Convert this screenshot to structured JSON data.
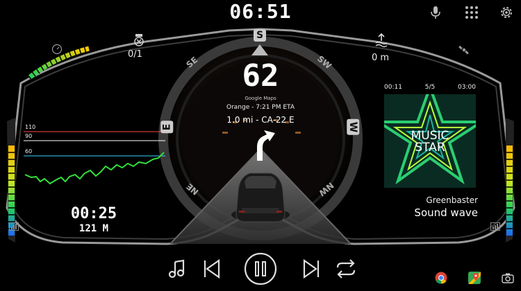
{
  "clock": "06:51",
  "icons": {
    "mic": "microphone-icon",
    "apps": "app-grid-icon",
    "settings": "gear-icon",
    "gauge": "gauge-icon",
    "counter": "counter-icon",
    "altitude": "altitude-icon",
    "satellite": "satellite-icon",
    "signal_left": "signal-icon",
    "signal_right": "signal-icon",
    "chrome": "chrome-icon",
    "maps": "maps-icon",
    "camera": "camera-icon"
  },
  "compass": {
    "s": "S",
    "se": "SE",
    "sw": "SW",
    "e": "E",
    "w": "W",
    "ne": "NE",
    "nw": "NW"
  },
  "speed": "62",
  "navigation": {
    "app": "Google Maps",
    "eta": "Orange - 7:21 PM ETA",
    "instruction": "1.0 mi - CA-22 E"
  },
  "counter": {
    "value": "0/1"
  },
  "altitude": {
    "value": "0 m"
  },
  "speed_graph": {
    "labels": [
      "110",
      "90",
      "60"
    ],
    "line_colors": [
      "#ff4a4a",
      "#ffffff",
      "#3fd0ff"
    ]
  },
  "trip": {
    "timer": "00:25",
    "distance": "121 M"
  },
  "media": {
    "elapsed": "00:11",
    "track": "5/5",
    "duration": "03:00",
    "album_line1": "MUSIC",
    "album_line2": "STAR",
    "artist": "Greenbaster",
    "song": "Sound wave"
  },
  "controls": [
    "music-note-icon",
    "previous-icon",
    "pause-icon",
    "next-icon",
    "repeat-icon"
  ],
  "accent": "#32e03a"
}
